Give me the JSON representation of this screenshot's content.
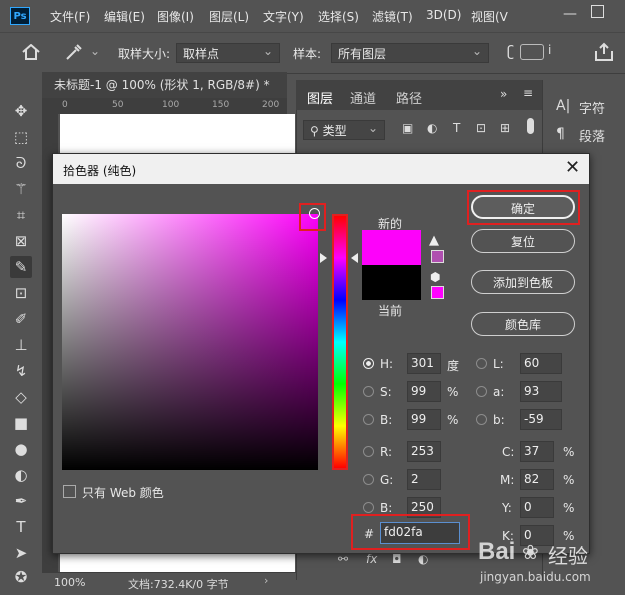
{
  "menubar": {
    "logo": "Ps",
    "items": [
      "文件(F)",
      "编辑(E)",
      "图像(I)",
      "图层(L)",
      "文字(Y)",
      "选择(S)",
      "滤镜(T)",
      "3D(D)",
      "视图(V"
    ]
  },
  "options": {
    "sample_size_label": "取样大小:",
    "sample_size_value": "取样点",
    "sample_label": "样本:",
    "sample_value": "所有图层"
  },
  "document": {
    "tab_title": "未标题-1 @ 100% (形状 1, RGB/8#) *",
    "ruler_ticks": [
      "0",
      "50",
      "100",
      "150",
      "200"
    ],
    "zoom": "100%",
    "doc_info": "文档:732.4K/0 字节"
  },
  "layers_panel": {
    "tabs": [
      "图层",
      "通道",
      "路径"
    ],
    "filter_placeholder": "类型"
  },
  "side_panel": {
    "items": [
      "字符",
      "段落"
    ]
  },
  "dialog": {
    "title": "拾色器 (纯色)",
    "new_label": "新的",
    "current_label": "当前",
    "new_color": "#fd02fa",
    "current_color": "#000000",
    "warning_color": "#b04fb0",
    "web_safe_color": "#ff00ff",
    "buttons": {
      "ok": "确定",
      "reset": "复位",
      "add_swatch": "添加到色板",
      "library": "颜色库"
    },
    "fields": {
      "H": {
        "label": "H:",
        "value": "301",
        "unit": "度"
      },
      "S": {
        "label": "S:",
        "value": "99",
        "unit": "%"
      },
      "B": {
        "label": "B:",
        "value": "99",
        "unit": "%"
      },
      "R": {
        "label": "R:",
        "value": "253"
      },
      "G": {
        "label": "G:",
        "value": "2"
      },
      "Bb": {
        "label": "B:",
        "value": "250"
      },
      "L": {
        "label": "L:",
        "value": "60"
      },
      "a": {
        "label": "a:",
        "value": "93"
      },
      "b": {
        "label": "b:",
        "value": "-59"
      },
      "C": {
        "label": "C:",
        "value": "37",
        "unit": "%"
      },
      "M": {
        "label": "M:",
        "value": "82",
        "unit": "%"
      },
      "Y": {
        "label": "Y:",
        "value": "0",
        "unit": "%"
      },
      "K": {
        "label": "K:",
        "value": "0",
        "unit": "%"
      }
    },
    "hex_label": "#",
    "hex_value": "fd02fa",
    "web_only_label": "只有 Web 颜色"
  },
  "watermark": {
    "brand": "Bai",
    "brand2": "经验",
    "url": "jingyan.baidu.com"
  }
}
